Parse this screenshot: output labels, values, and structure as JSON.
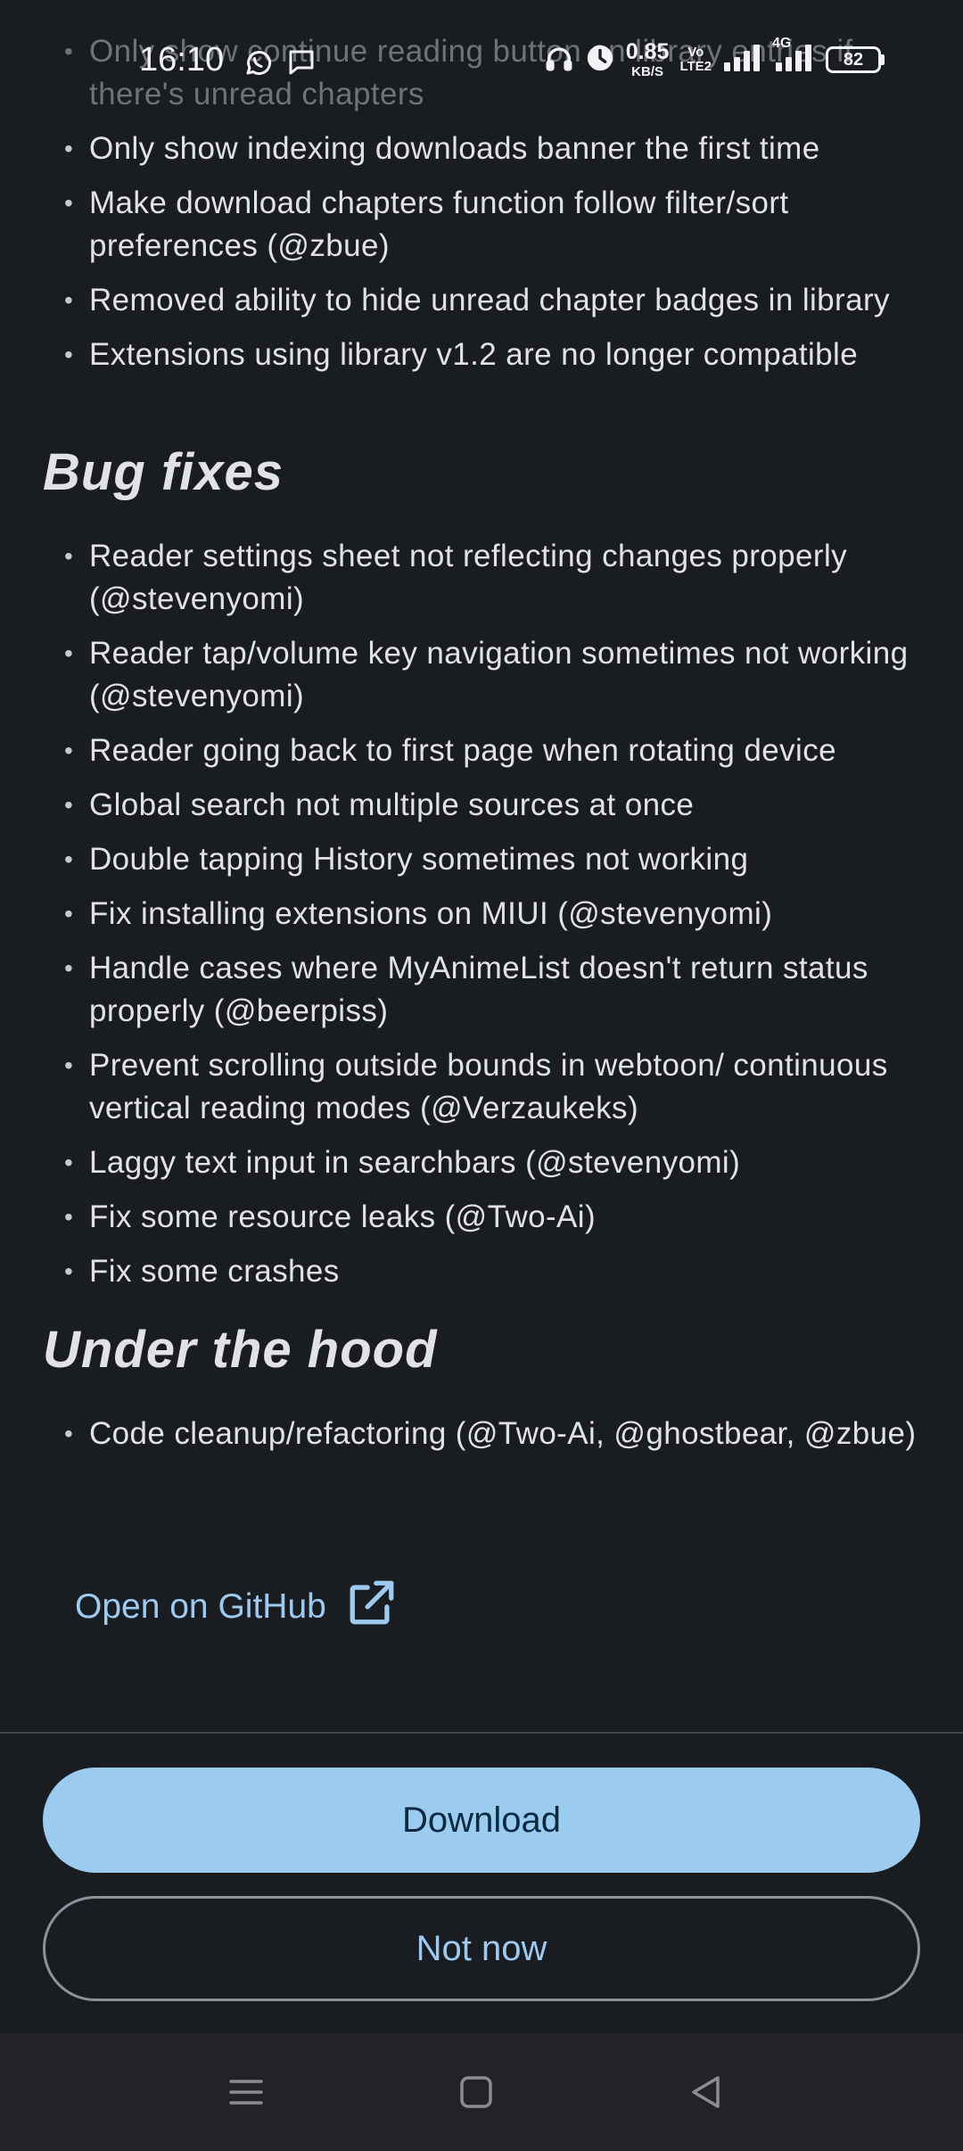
{
  "status_bar": {
    "time": "16:10",
    "net_speed_value": "0.85",
    "net_speed_unit": "KB/S",
    "volte_top": "Vo",
    "volte_bottom": "LTE2",
    "network_label": "4G",
    "battery": "82"
  },
  "changelog": {
    "faded_item": "Only show continue reading button on library entries if there's unread chapters",
    "changes": [
      "Only show indexing downloads banner the first time",
      "Make download chapters function follow filter/sort preferences (@zbue)",
      "Removed ability to hide unread chapter badges in library",
      "Extensions using library v1.2 are no longer compatible"
    ],
    "bug_fixes_heading": "Bug fixes",
    "bug_fixes": [
      "Reader settings sheet not reflecting changes properly (@stevenyomi)",
      "Reader tap/volume key navigation sometimes not working (@stevenyomi)",
      "Reader going back to first page when rotating device",
      "Global search not multiple sources at once",
      "Double tapping History sometimes not working",
      "Fix installing extensions on MIUI (@stevenyomi)",
      "Handle cases where MyAnimeList doesn't return status properly (@beerpiss)",
      "Prevent scrolling outside bounds in webtoon/ continuous vertical reading modes (@Verzaukeks)",
      "Laggy text input in searchbars (@stevenyomi)",
      "Fix some resource leaks (@Two-Ai)",
      "Fix some crashes"
    ],
    "under_the_hood_heading": "Under the hood",
    "under_the_hood": [
      "Code cleanup/refactoring (@Two-Ai, @ghostbear, @zbue)"
    ]
  },
  "actions": {
    "github_label": "Open on GitHub",
    "download_label": "Download",
    "not_now_label": "Not now"
  },
  "icons": {
    "status_left": [
      "whatsapp-icon",
      "message-icon"
    ],
    "status_right": [
      "headphones-icon",
      "alarm-icon",
      "signal-icon",
      "signal-4g-icon",
      "battery-icon"
    ],
    "github_link": "open-external-icon",
    "nav": [
      "menu-icon",
      "home-square-icon",
      "back-triangle-icon"
    ]
  },
  "colors": {
    "background": "#191c20",
    "text": "#e2e2e6",
    "accent": "#9ccbf0",
    "download_text": "#0b2a42",
    "outline": "#8e9199",
    "nav_bar": "#212329"
  }
}
